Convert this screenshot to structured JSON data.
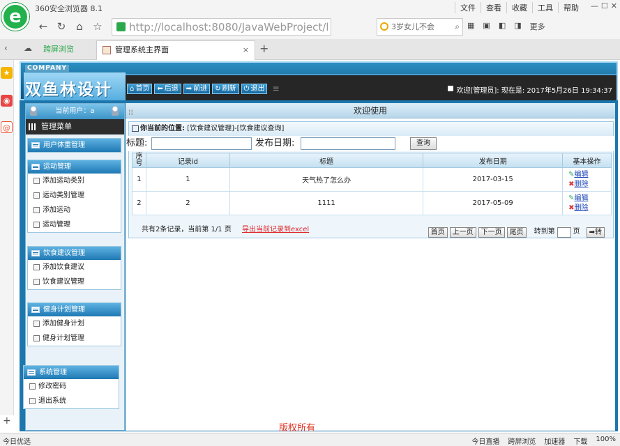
{
  "browser": {
    "title": "360安全浏览器 8.1",
    "menu": [
      "文件",
      "查看",
      "收藏",
      "工具",
      "帮助"
    ],
    "url_host": "http://localhost",
    "url_rest": ":8080/JavaWebProject/login/l",
    "search_text": "3岁女儿不会",
    "toolbar_more": "更多",
    "tab_splitscreen": "跨屏浏览",
    "tab_title": "管理系统主界面",
    "status_left": "今日优选",
    "status_items": [
      "今日直播",
      "跨屏浏览",
      "加速器",
      "下载",
      "100%"
    ]
  },
  "banner": {
    "company_tag": "COMPANY",
    "logo_text": "双鱼林设计",
    "nav": [
      {
        "label": "首页",
        "icon": "⌂"
      },
      {
        "label": "后退",
        "icon": "⬅"
      },
      {
        "label": "前进",
        "icon": "➡"
      },
      {
        "label": "刷新",
        "icon": "↻"
      },
      {
        "label": "退出",
        "icon": "⏻"
      }
    ],
    "welcome": "欢迎[管理员]:  现在是: 2017年5月26日 19:34:37"
  },
  "sidebar": {
    "current_user": "当前用户：a",
    "menu_title": "管理菜单",
    "groups": [
      {
        "title": "用户体重管理",
        "items": []
      },
      {
        "title": "运动管理",
        "items": [
          "添加运动类别",
          "运动类别管理",
          "添加运动",
          "运动管理"
        ]
      },
      {
        "title": "饮食建议管理",
        "items": [
          "添加饮食建议",
          "饮食建议管理"
        ]
      },
      {
        "title": "健身计划管理",
        "items": [
          "添加健身计划",
          "健身计划管理"
        ]
      },
      {
        "title": "系统管理",
        "items": [
          "修改密码",
          "退出系统"
        ]
      }
    ]
  },
  "main": {
    "header": "欢迎使用",
    "location_label": "你当前的位置:",
    "location_path": "[饮食建议管理]-[饮食建议查询]",
    "search": {
      "title_label": "标题:",
      "title_value": "",
      "date_label": "发布日期:",
      "date_value": "",
      "query_button": "查询"
    },
    "table": {
      "headers": [
        "序号",
        "记录id",
        "标题",
        "发布日期",
        "基本操作"
      ],
      "rows": [
        {
          "seq": "1",
          "id": "1",
          "title": "天气热了怎么办",
          "date": "2017-03-15"
        },
        {
          "seq": "2",
          "id": "2",
          "title": "1111",
          "date": "2017-05-09"
        }
      ],
      "edit_label": "编辑",
      "delete_label": "删除"
    },
    "pager": {
      "summary": "共有2条记录，当前第 1/1 页",
      "export": "导出当前记录到excel",
      "first": "首页",
      "prev": "上一页",
      "next": "下一页",
      "last": "尾页",
      "goto_label": "转到第",
      "page_unit": "页",
      "go": "转"
    }
  },
  "footer": {
    "copyright": "版权所有"
  }
}
